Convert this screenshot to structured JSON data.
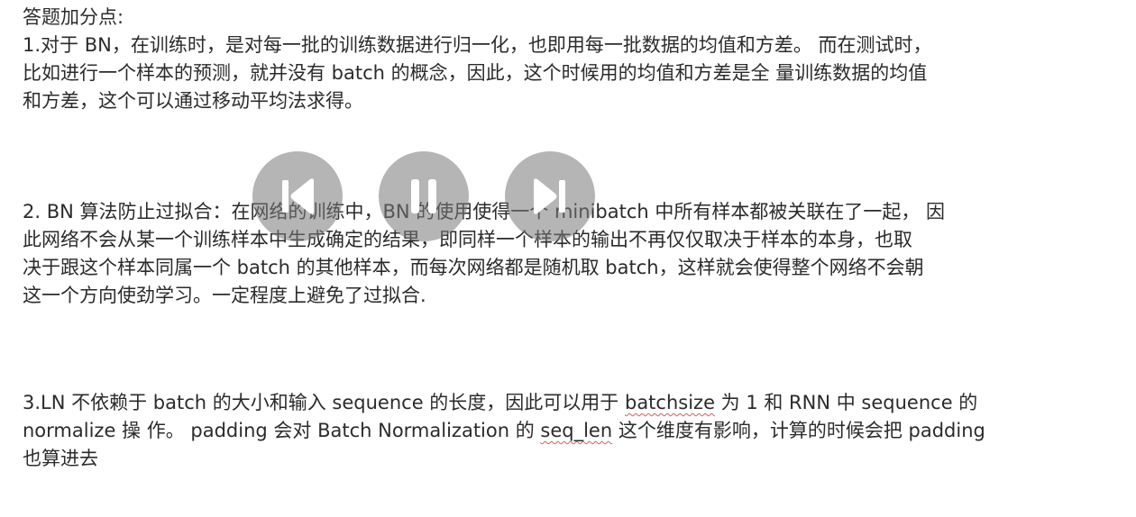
{
  "doc": {
    "heading": "答题加分点:",
    "p1": [
      "1.对于 BN，在训练时，是对每一批的训练数据进行归一化，也即用每一批数据的均值和方差。 而在测试时，",
      "比如进行一个样本的预测，就并没有 batch 的概念，因此，这个时候用的均值和方差是全 量训练数据的均值",
      "和方差，这个可以通过移动平均法求得。"
    ],
    "p2": [
      "2. BN 算法防止过拟合：在网络的训练中，BN 的使用使得一个 minibatch 中所有样本都被关联在了一起，  因",
      "此网络不会从某一个训练样本中生成确定的结果，即同样一个样本的输出不再仅仅取决于样本的本身，也取",
      "决于跟这个样本同属一个 batch 的其他样本，而每次网络都是随机取 batch，这样就会使得整个网络不会朝",
      "这一个方向使劲学习。一定程度上避免了过拟合."
    ],
    "p3": {
      "l1_a": "3.LN 不依赖于 batch 的大小和输入 sequence 的长度，因此可以用于 ",
      "l1_b": "batchsize",
      "l1_c": " 为 1 和 RNN 中 sequence 的",
      "l2_a": "normalize 操 作。 padding 会对 Batch Normalization 的 ",
      "l2_b": "seq_len",
      "l2_c": " 这个维度有影响，计算的时候会把 padding",
      "l3": "也算进去"
    }
  },
  "player": {
    "prev_icon": "skip-previous-icon",
    "pause_icon": "pause-icon",
    "next_icon": "skip-next-icon",
    "overlay_color": "#787878"
  }
}
